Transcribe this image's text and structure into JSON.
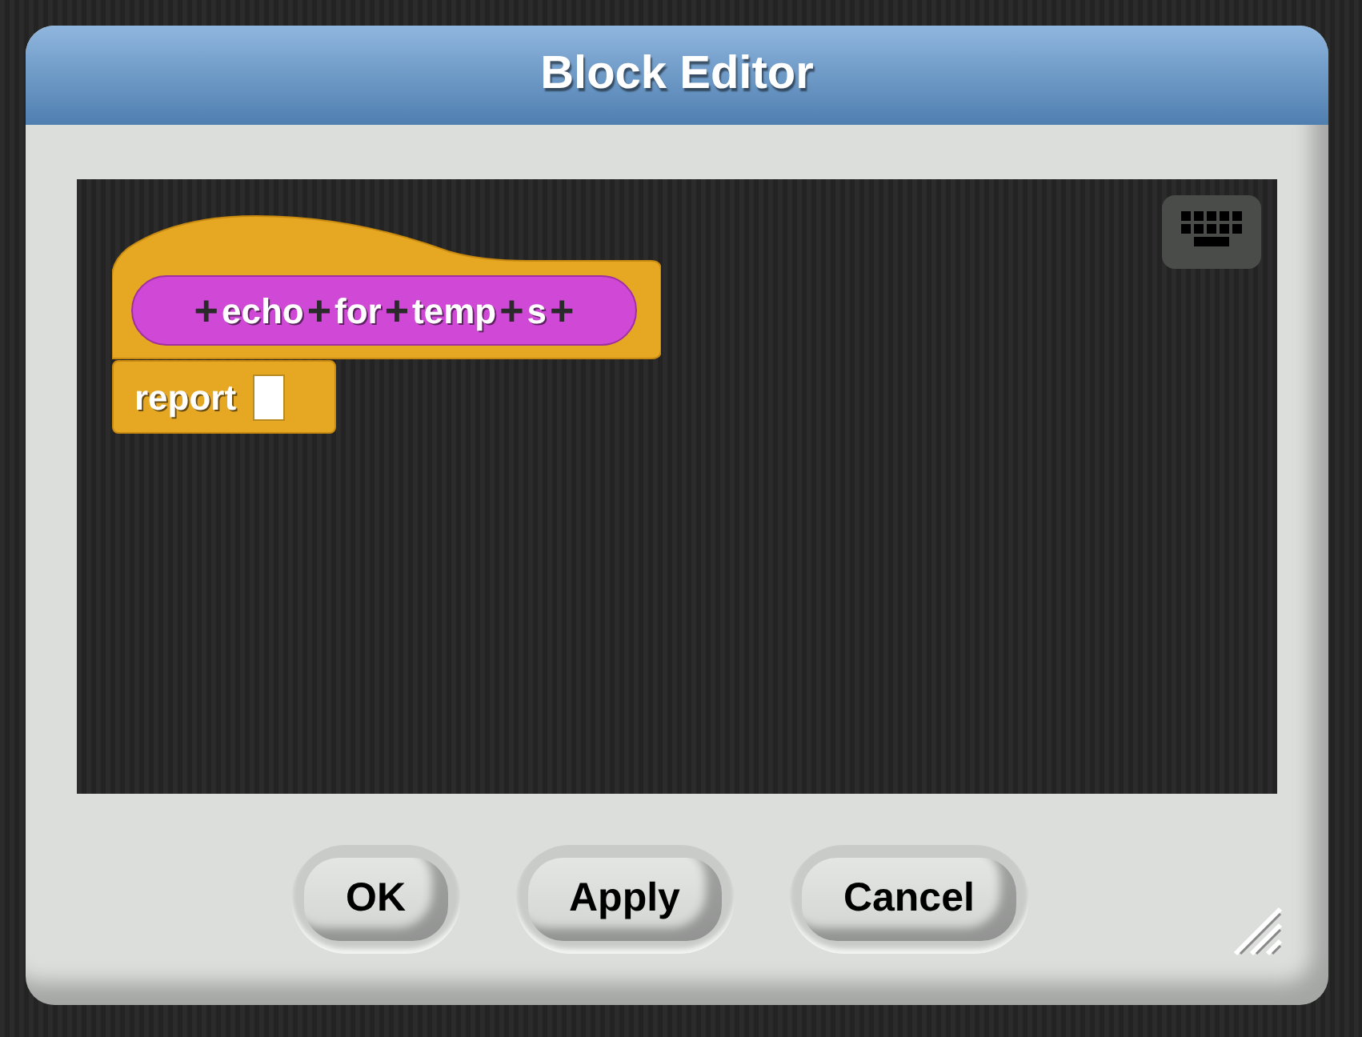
{
  "window": {
    "title": "Block Editor"
  },
  "script": {
    "prototype": [
      {
        "kind": "plus",
        "text": "+"
      },
      {
        "kind": "word",
        "text": "echo"
      },
      {
        "kind": "plus",
        "text": "+"
      },
      {
        "kind": "word",
        "text": "for"
      },
      {
        "kind": "plus",
        "text": "+"
      },
      {
        "kind": "word",
        "text": "temp"
      },
      {
        "kind": "plus",
        "text": "+"
      },
      {
        "kind": "word",
        "text": "s"
      },
      {
        "kind": "plus",
        "text": "+"
      }
    ],
    "command": {
      "label": "report"
    }
  },
  "buttons": [
    "OK",
    "Apply",
    "Cancel"
  ]
}
